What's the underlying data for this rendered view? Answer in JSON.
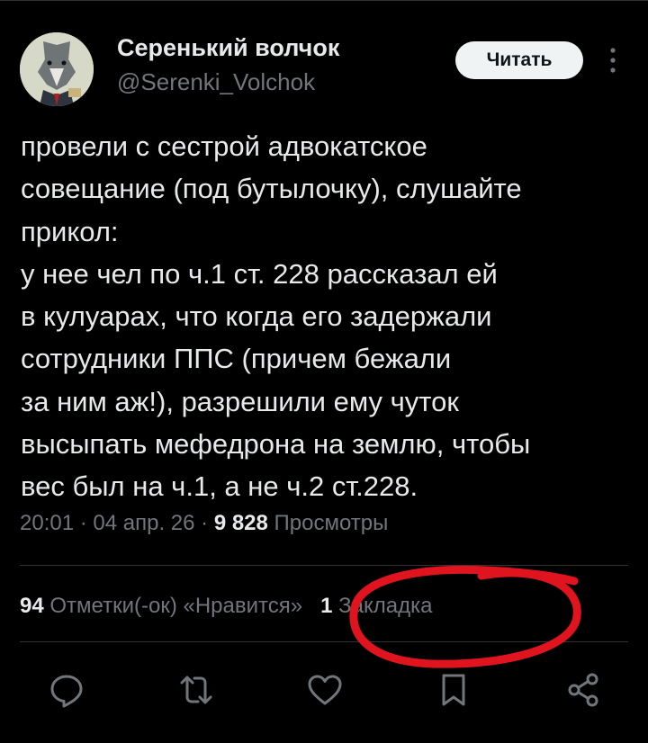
{
  "author": {
    "display_name": "Серенький волчок",
    "handle": "@Serenki_Volchok",
    "avatar_icon": "wolf-in-suit-avatar"
  },
  "follow_button": {
    "label": "Читать"
  },
  "more_icon": "vertical-ellipsis-icon",
  "tweet": {
    "text": "провели с сестрой адвокатское\nсовещание (под бутылочку), слушайте\nприкол:\nу нее чел по ч.1 ст. 228 рассказал ей\nв кулуарах, что когда его задержали\nсотрудники ППС (причем бежали\nза ним аж!), разрешили ему чуток\nвысыпать мефедрона на землю, чтобы\nвес был на ч.1, а не ч.2 ст.228.",
    "time": "20:01",
    "sep1": " · ",
    "date": "04 апр. 26",
    "sep2": " · ",
    "views_count": "9 828",
    "views_label": " Просмотры"
  },
  "stats": {
    "likes_count": "94",
    "likes_label": " Отметки(-ок) «Нравится»",
    "bookmarks_count": "1",
    "bookmarks_label": " Закладка"
  },
  "actions": [
    {
      "name": "reply-icon"
    },
    {
      "name": "repost-icon"
    },
    {
      "name": "like-icon"
    },
    {
      "name": "bookmark-icon"
    },
    {
      "name": "share-icon"
    }
  ],
  "colors": {
    "background": "#000000",
    "text_primary": "#e7e9ea",
    "text_secondary": "#71767b",
    "annotation_red": "#e0141e"
  }
}
